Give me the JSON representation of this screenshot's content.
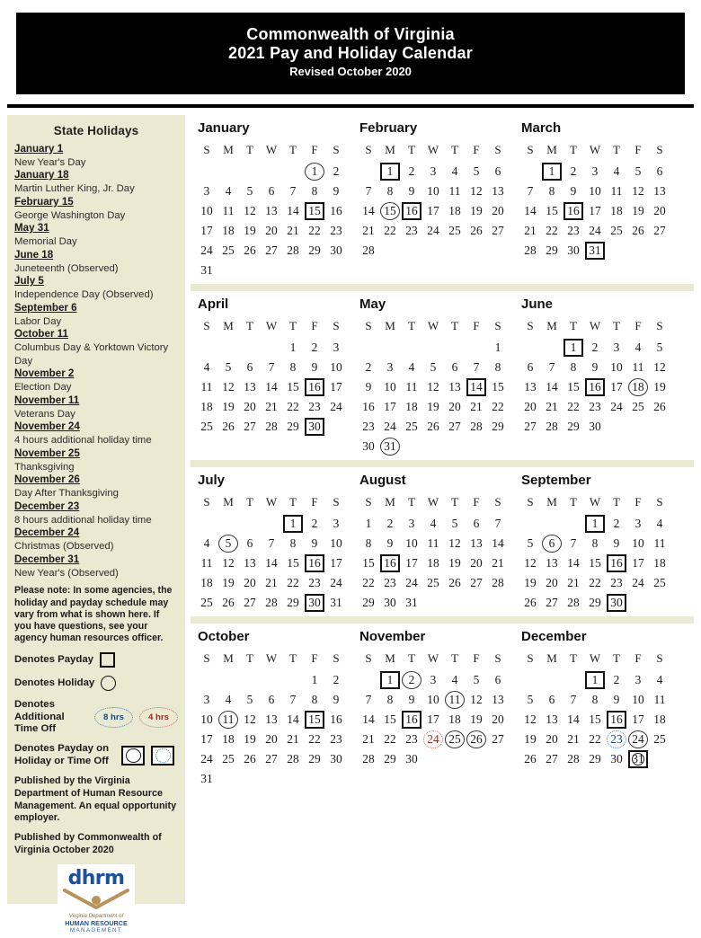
{
  "banner": {
    "line1": "Commonwealth of Virginia",
    "line2": "2021 Pay and Holiday Calendar",
    "line3": "Revised October 2020"
  },
  "sidebar": {
    "title": "State Holidays",
    "holidays": [
      {
        "date": "January 1",
        "name": "New Year's Day"
      },
      {
        "date": "January 18",
        "name": "Martin Luther King, Jr. Day"
      },
      {
        "date": "February 15",
        "name": "George Washington Day"
      },
      {
        "date": "May 31",
        "name": "Memorial Day"
      },
      {
        "date": "June 18",
        "name": "Juneteenth (Observed)"
      },
      {
        "date": "July 5",
        "name": "Independence Day (Observed)"
      },
      {
        "date": "September 6",
        "name": "Labor Day"
      },
      {
        "date": "October 11",
        "name": "Columbus Day & Yorktown Victory Day"
      },
      {
        "date": "November 2",
        "name": "Election Day"
      },
      {
        "date": "November 11",
        "name": "Veterans Day"
      },
      {
        "date": "November 24",
        "name": "4 hours additional holiday time"
      },
      {
        "date": "November 25",
        "name": "Thanksgiving"
      },
      {
        "date": "November 26",
        "name": "Day After Thanksgiving"
      },
      {
        "date": "December 23",
        "name": "8 hours additional holiday time"
      },
      {
        "date": "December 24",
        "name": "Christmas (Observed)"
      },
      {
        "date": "December 31",
        "name": "New Year's (Observed)"
      }
    ],
    "note": "Please note:  In some agencies, the holiday and payday schedule may vary from what is shown here.  If you have questions, see your agency human resources officer.",
    "legend": {
      "payday": "Denotes Payday",
      "holiday": "Denotes Holiday",
      "additional_time_off": "Denotes Additional Time Off",
      "chip_8": "8 hrs",
      "chip_4": "4 hrs",
      "payday_on_holiday": "Denotes Payday on Holiday or Time Off"
    },
    "published_1": "Published by the Virginia Department of Human Resource Management. An equal opportunity employer.",
    "published_2": "Published by Commonwealth of Virginia October 2020",
    "logo": {
      "wordmark": "dhrm",
      "line1": "Virginia Department of",
      "line2": "HUMAN RESOURCE",
      "line3": "MANAGEMENT"
    }
  },
  "colors": {
    "banner_bg": "#000000",
    "sidebar_bg": "#eaead3",
    "accent_blue": "#3f7fd0",
    "accent_red": "#d06a63",
    "logo_blue": "#1b4fa0",
    "logo_tan": "#b8935a"
  },
  "weekday_headers": [
    "S",
    "M",
    "T",
    "W",
    "T",
    "F",
    "S"
  ],
  "months": [
    {
      "name": "January",
      "start": 5,
      "days": 31,
      "payday": [
        15
      ],
      "holiday": [
        1
      ],
      "payday_holiday": [],
      "time8": [],
      "time4": []
    },
    {
      "name": "February",
      "start": 1,
      "days": 28,
      "payday": [
        1,
        16
      ],
      "holiday": [
        15
      ],
      "payday_holiday": [],
      "time8": [],
      "time4": []
    },
    {
      "name": "March",
      "start": 1,
      "days": 31,
      "payday": [
        1,
        16,
        31
      ],
      "holiday": [],
      "payday_holiday": [],
      "time8": [],
      "time4": []
    },
    {
      "name": "April",
      "start": 4,
      "days": 30,
      "payday": [
        16,
        30
      ],
      "holiday": [],
      "payday_holiday": [],
      "time8": [],
      "time4": []
    },
    {
      "name": "May",
      "start": 6,
      "days": 31,
      "payday": [
        14
      ],
      "holiday": [
        31
      ],
      "payday_holiday": [],
      "time8": [],
      "time4": []
    },
    {
      "name": "June",
      "start": 2,
      "days": 30,
      "payday": [
        1,
        16
      ],
      "holiday": [
        18
      ],
      "payday_holiday": [],
      "time8": [],
      "time4": []
    },
    {
      "name": "July",
      "start": 4,
      "days": 31,
      "payday": [
        1,
        16,
        30
      ],
      "holiday": [
        5
      ],
      "payday_holiday": [],
      "time8": [],
      "time4": []
    },
    {
      "name": "August",
      "start": 0,
      "days": 31,
      "payday": [
        16
      ],
      "holiday": [],
      "payday_holiday": [],
      "time8": [],
      "time4": []
    },
    {
      "name": "September",
      "start": 3,
      "days": 30,
      "payday": [
        1,
        16,
        30
      ],
      "holiday": [
        6
      ],
      "payday_holiday": [],
      "time8": [],
      "time4": []
    },
    {
      "name": "October",
      "start": 5,
      "days": 31,
      "payday": [
        15
      ],
      "holiday": [
        11
      ],
      "payday_holiday": [],
      "time8": [],
      "time4": []
    },
    {
      "name": "November",
      "start": 1,
      "days": 30,
      "payday": [
        1,
        16
      ],
      "holiday": [
        2,
        11,
        25,
        26
      ],
      "payday_holiday": [],
      "time8": [],
      "time4": [
        24
      ]
    },
    {
      "name": "December",
      "start": 3,
      "days": 31,
      "payday": [
        1,
        16
      ],
      "holiday": [
        24
      ],
      "payday_holiday": [
        31
      ],
      "time8": [
        23
      ],
      "time4": []
    }
  ]
}
